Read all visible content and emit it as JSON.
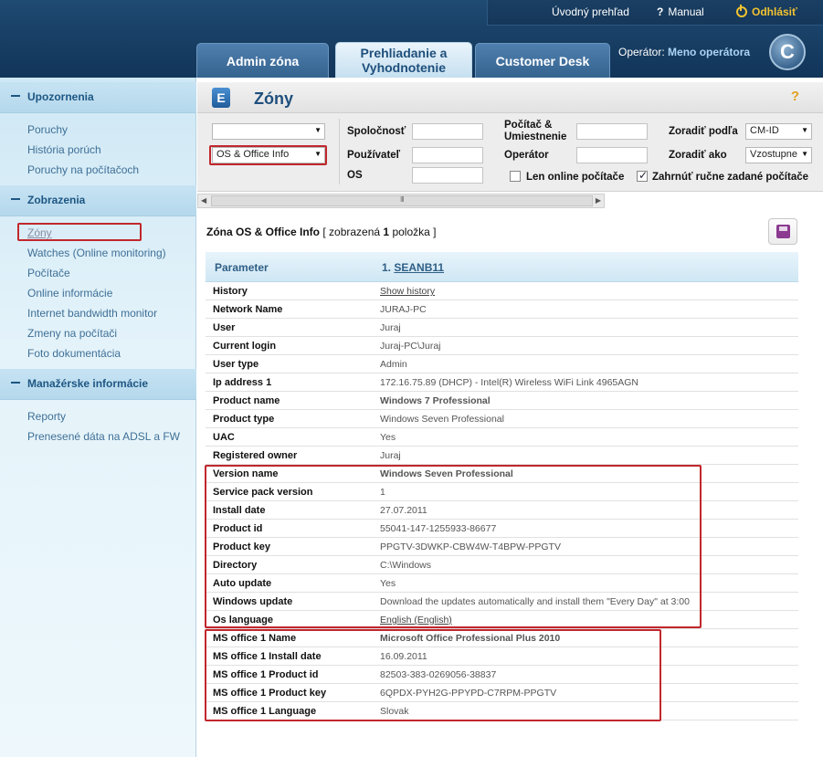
{
  "topbar": {
    "home": "Úvodný prehľad",
    "manual": "Manual",
    "logout": "Odhlásiť"
  },
  "tabs": [
    {
      "label": "Admin zóna"
    },
    {
      "label": "Prehliadanie a Vyhodnotenie"
    },
    {
      "label": "Customer Desk"
    }
  ],
  "operator": {
    "label": "Operátor:",
    "name": "Meno operátora"
  },
  "logo_letter": "C",
  "sidebar": {
    "sections": [
      {
        "title": "Upozornenia",
        "items": [
          "Poruchy",
          "História porúch",
          "Poruchy na počítačoch"
        ]
      },
      {
        "title": "Zobrazenia",
        "items": [
          "Zóny",
          "Watches (Online monitoring)",
          "Počítače",
          "Online informácie",
          "Internet bandwidth monitor",
          "Zmeny na počítači",
          "Foto dokumentácia"
        ]
      },
      {
        "title": "Manažérske informácie",
        "items": [
          "Reporty",
          "Prenesené dáta na ADSL a FW"
        ]
      }
    ]
  },
  "page": {
    "title": "Zóny",
    "help": "?"
  },
  "filters": {
    "zone_select_1": "",
    "zone_select_2": "OS & Office Info",
    "company_label": "Spoločnosť",
    "user_label": "Používateľ",
    "os_label": "OS",
    "computer_label": "Počítač & Umiestnenie",
    "operator_label": "Operátor",
    "online_only_label": "Len online počítače",
    "include_manual_label": "Zahrnúť ručne zadané počítače",
    "sort_by_label": "Zoradiť podľa",
    "sort_by_value": "CM-ID",
    "sort_as_label": "Zoradiť ako",
    "sort_as_value": "Vzostupne",
    "online_only_checked": false,
    "include_manual_checked": true
  },
  "zone": {
    "prefix": "Zóna OS & Office Info",
    "shown_open": "[ zobrazená",
    "count": "1",
    "shown_close": "položka ]"
  },
  "table": {
    "col_param": "Parameter",
    "col_index": "1.",
    "col_computer": "SEANB11",
    "rows": [
      {
        "key": "History",
        "value": "Show history"
      },
      {
        "key": "Network Name",
        "value": "JURAJ-PC"
      },
      {
        "key": "User",
        "value": "Juraj"
      },
      {
        "key": "Current login",
        "value": "Juraj-PC\\Juraj"
      },
      {
        "key": "User type",
        "value": "Admin"
      },
      {
        "key": "Ip address 1",
        "value": "172.16.75.89 (DHCP) - Intel(R) Wireless WiFi Link 4965AGN"
      },
      {
        "key": "Product name",
        "value": "Windows 7 Professional"
      },
      {
        "key": "Product type",
        "value": "Windows Seven Professional"
      },
      {
        "key": "UAC",
        "value": "Yes"
      },
      {
        "key": "Registered owner",
        "value": "Juraj"
      },
      {
        "key": "Version name",
        "value": "Windows Seven Professional"
      },
      {
        "key": "Service pack version",
        "value": "1"
      },
      {
        "key": "Install date",
        "value": "27.07.2011"
      },
      {
        "key": "Product id",
        "value": "55041-147-1255933-86677"
      },
      {
        "key": "Product key",
        "value": "PPGTV-3DWKP-CBW4W-T4BPW-PPGTV"
      },
      {
        "key": "Directory",
        "value": "C:\\Windows"
      },
      {
        "key": "Auto update",
        "value": "Yes"
      },
      {
        "key": "Windows update",
        "value": "Download the updates automatically and install them \"Every Day\" at 3:00"
      },
      {
        "key": "Os language",
        "value": "English (English)"
      },
      {
        "key": "MS office 1 Name",
        "value": "Microsoft Office Professional Plus 2010"
      },
      {
        "key": "MS office 1 Install date",
        "value": "16.09.2011"
      },
      {
        "key": "MS office 1 Product id",
        "value": "82503-383-0269056-38837"
      },
      {
        "key": "MS office 1 Product key",
        "value": "6QPDX-PYH2G-PPYPD-C7RPM-PPGTV"
      },
      {
        "key": "MS office 1 Language",
        "value": "Slovak"
      }
    ]
  }
}
